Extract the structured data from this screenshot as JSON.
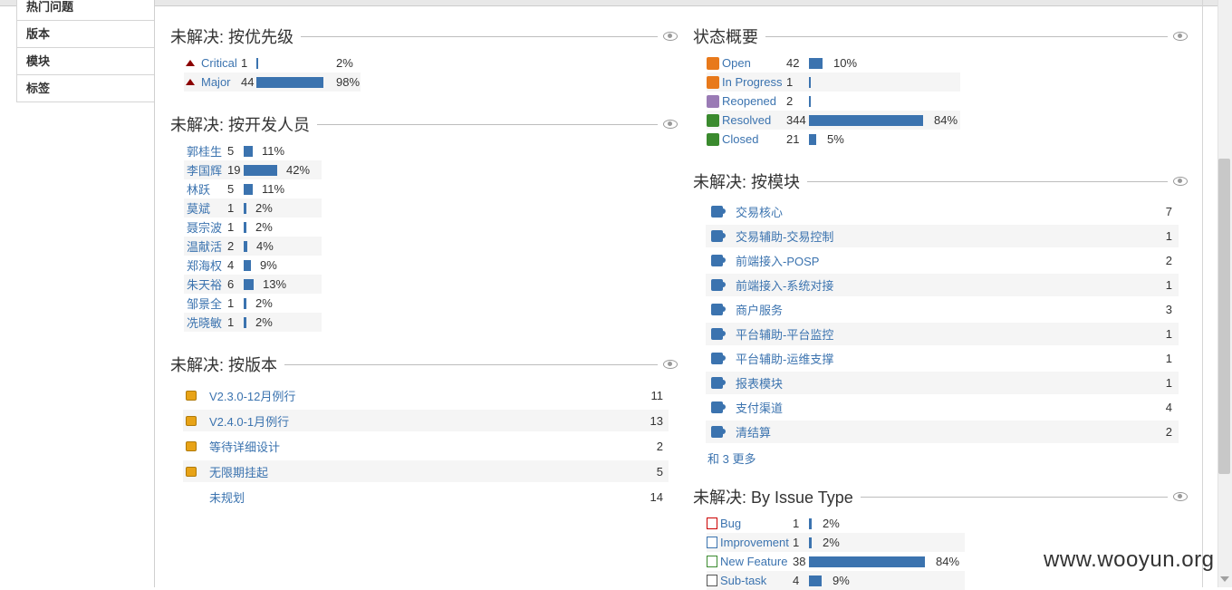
{
  "sidebar": {
    "items": [
      "热门问题",
      "版本",
      "模块",
      "标签"
    ]
  },
  "priority": {
    "title": "未解决: 按优先级",
    "rows": [
      {
        "name": "Critical",
        "count": "1",
        "pct": "2%",
        "fraction": 0.02
      },
      {
        "name": "Major",
        "count": "44",
        "pct": "98%",
        "fraction": 0.98
      }
    ]
  },
  "developer": {
    "title": "未解决: 按开发人员",
    "rows": [
      {
        "name": "郭桂生",
        "count": "5",
        "pct": "11%",
        "fraction": 0.11
      },
      {
        "name": "李国辉",
        "count": "19",
        "pct": "42%",
        "fraction": 0.42
      },
      {
        "name": "林跃",
        "count": "5",
        "pct": "11%",
        "fraction": 0.11
      },
      {
        "name": "莫斌",
        "count": "1",
        "pct": "2%",
        "fraction": 0.02
      },
      {
        "name": "聂宗波",
        "count": "1",
        "pct": "2%",
        "fraction": 0.02
      },
      {
        "name": "温献活",
        "count": "2",
        "pct": "4%",
        "fraction": 0.04
      },
      {
        "name": "郑海权",
        "count": "4",
        "pct": "9%",
        "fraction": 0.09
      },
      {
        "name": "朱天裕",
        "count": "6",
        "pct": "13%",
        "fraction": 0.13
      },
      {
        "name": "邹景全",
        "count": "1",
        "pct": "2%",
        "fraction": 0.02
      },
      {
        "name": "冼晓敏",
        "count": "1",
        "pct": "2%",
        "fraction": 0.02
      }
    ]
  },
  "version": {
    "title": "未解决: 按版本",
    "rows": [
      {
        "name": "V2.3.0-12月例行",
        "count": "11",
        "icon": "version-icon"
      },
      {
        "name": "V2.4.0-1月例行",
        "count": "13",
        "icon": "version-icon"
      },
      {
        "name": "等待详细设计",
        "count": "2",
        "icon": "version-icon"
      },
      {
        "name": "无限期挂起",
        "count": "5",
        "icon": "version-icon"
      },
      {
        "name": "未规划",
        "count": "14",
        "icon": ""
      }
    ]
  },
  "status": {
    "title": "状态概要",
    "rows": [
      {
        "name": "Open",
        "count": "42",
        "pct": "10%",
        "fraction": 0.1,
        "icon": "open-status-icon",
        "color": "#e8791b"
      },
      {
        "name": "In Progress",
        "count": "1",
        "pct": "",
        "fraction": 0.003,
        "icon": "in-progress-status-icon",
        "color": "#e8791b"
      },
      {
        "name": "Reopened",
        "count": "2",
        "pct": "",
        "fraction": 0.005,
        "icon": "reopened-status-icon",
        "color": "#9a7bb5"
      },
      {
        "name": "Resolved",
        "count": "344",
        "pct": "84%",
        "fraction": 0.84,
        "icon": "resolved-status-icon",
        "color": "#3a8a2e"
      },
      {
        "name": "Closed",
        "count": "21",
        "pct": "5%",
        "fraction": 0.05,
        "icon": "closed-status-icon",
        "color": "#3a8a2e"
      }
    ]
  },
  "component": {
    "title": "未解决: 按模块",
    "rows": [
      {
        "name": "交易核心",
        "count": "7"
      },
      {
        "name": "交易辅助-交易控制",
        "count": "1"
      },
      {
        "name": "前端接入-POSP",
        "count": "2"
      },
      {
        "name": "前端接入-系统对接",
        "count": "1"
      },
      {
        "name": "商户服务",
        "count": "3"
      },
      {
        "name": "平台辅助-平台监控",
        "count": "1"
      },
      {
        "name": "平台辅助-运维支撑",
        "count": "1"
      },
      {
        "name": "报表模块",
        "count": "1"
      },
      {
        "name": "支付渠道",
        "count": "4"
      },
      {
        "name": "清结算",
        "count": "2"
      }
    ],
    "more": "和 3 更多"
  },
  "issuetype": {
    "title": "未解决: By Issue Type",
    "rows": [
      {
        "name": "Bug",
        "count": "1",
        "pct": "2%",
        "fraction": 0.02,
        "icon": "bug-icon",
        "color": "#cc0000"
      },
      {
        "name": "Improvement",
        "count": "1",
        "pct": "2%",
        "fraction": 0.02,
        "icon": "improvement-icon",
        "color": "#3b73af"
      },
      {
        "name": "New Feature",
        "count": "38",
        "pct": "84%",
        "fraction": 0.84,
        "icon": "new-feature-icon",
        "color": "#3a8a2e"
      },
      {
        "name": "Sub-task",
        "count": "4",
        "pct": "9%",
        "fraction": 0.09,
        "icon": "sub-task-icon",
        "color": "#555555"
      }
    ]
  },
  "watermark": "www.wooyun.org"
}
